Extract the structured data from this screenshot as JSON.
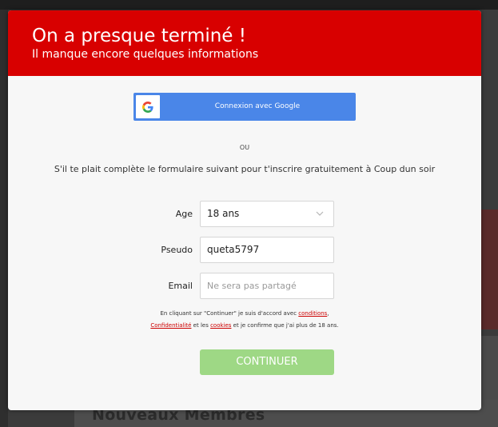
{
  "background": {
    "section_title": "Nouveaux Membres"
  },
  "modal": {
    "title": "On a presque terminé !",
    "subtitle": "Il manque encore quelques informations",
    "google_button": {
      "label": "Connexion avec Google",
      "icon": "google-g-icon"
    },
    "separator": "OU",
    "intro": "S'il te plait complète le formulaire suivant pour t'inscrire gratuitement à Coup dun soir",
    "fields": {
      "age": {
        "label": "Age",
        "value": "18 ans"
      },
      "pseudo": {
        "label": "Pseudo",
        "value": "queta5797"
      },
      "email": {
        "label": "Email",
        "value": "",
        "placeholder": "Ne sera pas partagé"
      }
    },
    "consent": {
      "part1": "En cliquant sur \"Continuer\" je suis d'accord avec ",
      "link_conditions": "conditions",
      "part2": ",",
      "link_confidentialite": "Confidentialité",
      "part3": " et les ",
      "link_cookies": "cookies",
      "part4": " et je confirme que j'ai plus de 18 ans."
    },
    "continue_button": "CONTINUER"
  },
  "colors": {
    "header_red": "#d80000",
    "google_blue": "#4a86e8",
    "continue_green": "#9ed885",
    "link_red": "#cc0000"
  }
}
